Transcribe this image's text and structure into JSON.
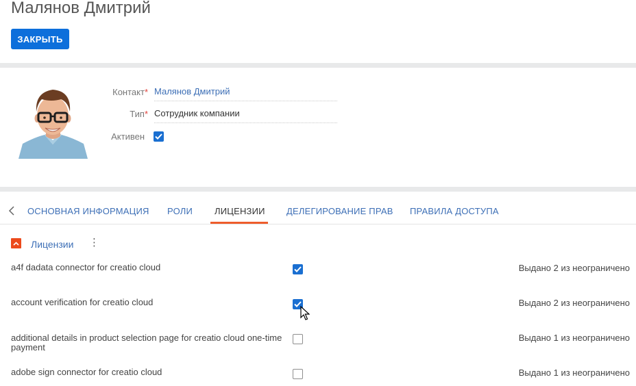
{
  "header": {
    "title": "Малянов Дмитрий",
    "close_label": "ЗАКРЫТЬ"
  },
  "profile": {
    "contact_label": "Контакт",
    "contact_value": "Малянов Дмитрий",
    "type_label": "Тип",
    "type_value": "Сотрудник компании",
    "active_label": "Активен",
    "active_checked": true
  },
  "tabs": [
    {
      "label": "ОСНОВНАЯ ИНФОРМАЦИЯ"
    },
    {
      "label": "РОЛИ"
    },
    {
      "label": "ЛИЦЕНЗИИ",
      "active": true
    },
    {
      "label": "ДЕЛЕГИРОВАНИЕ ПРАВ"
    },
    {
      "label": "ПРАВИЛА ДОСТУПА"
    }
  ],
  "licenses": {
    "title": "Лицензии",
    "items": [
      {
        "name": "a4f dadata connector for creatio cloud",
        "checked": true,
        "status": "Выдано 2 из неограничено"
      },
      {
        "name": "account verification for creatio cloud",
        "checked": true,
        "status": "Выдано 2 из неограничено"
      },
      {
        "name": "additional details in product selection page for creatio cloud one-time payment",
        "checked": false,
        "status": "Выдано 1 из неограничено"
      },
      {
        "name": "adobe sign connector for creatio cloud",
        "checked": false,
        "status": "Выдано 1 из неограничено"
      }
    ]
  },
  "colors": {
    "accent_blue": "#0d6fdb",
    "link_blue": "#3d6fb6",
    "active_tab_orange": "#ee5c2c"
  }
}
